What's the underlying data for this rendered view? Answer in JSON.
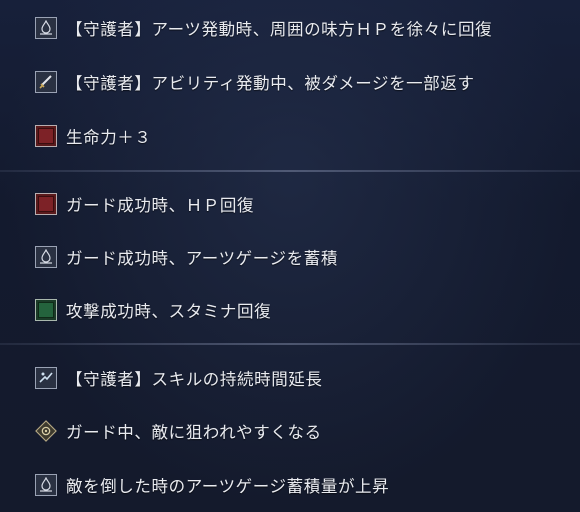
{
  "rows": [
    {
      "label": "【守護者】アーツ発動時、周囲の味方ＨＰを徐々に回復",
      "icon": "arts-icon"
    },
    {
      "label": "【守護者】アビリティ発動中、被ダメージを一部返す",
      "icon": "sword-icon"
    },
    {
      "label": "生命力＋３",
      "icon": "vitality-icon"
    },
    {
      "label": "ガード成功時、ＨＰ回復",
      "icon": "hp-flask-icon"
    },
    {
      "label": "ガード成功時、アーツゲージを蓄積",
      "icon": "arts-icon"
    },
    {
      "label": "攻撃成功時、スタミナ回復",
      "icon": "stamina-flask-icon"
    },
    {
      "label": "【守護者】スキルの持続時間延長",
      "icon": "skill-icon"
    },
    {
      "label": "ガード中、敵に狙われやすくなる",
      "icon": "taunt-icon"
    },
    {
      "label": "敵を倒した時のアーツゲージ蓄積量が上昇",
      "icon": "arts-icon"
    }
  ],
  "colors": {
    "background": "#141a2c",
    "text": "#e9ebf0",
    "vitality": "#7d2227",
    "stamina": "#24633d"
  }
}
